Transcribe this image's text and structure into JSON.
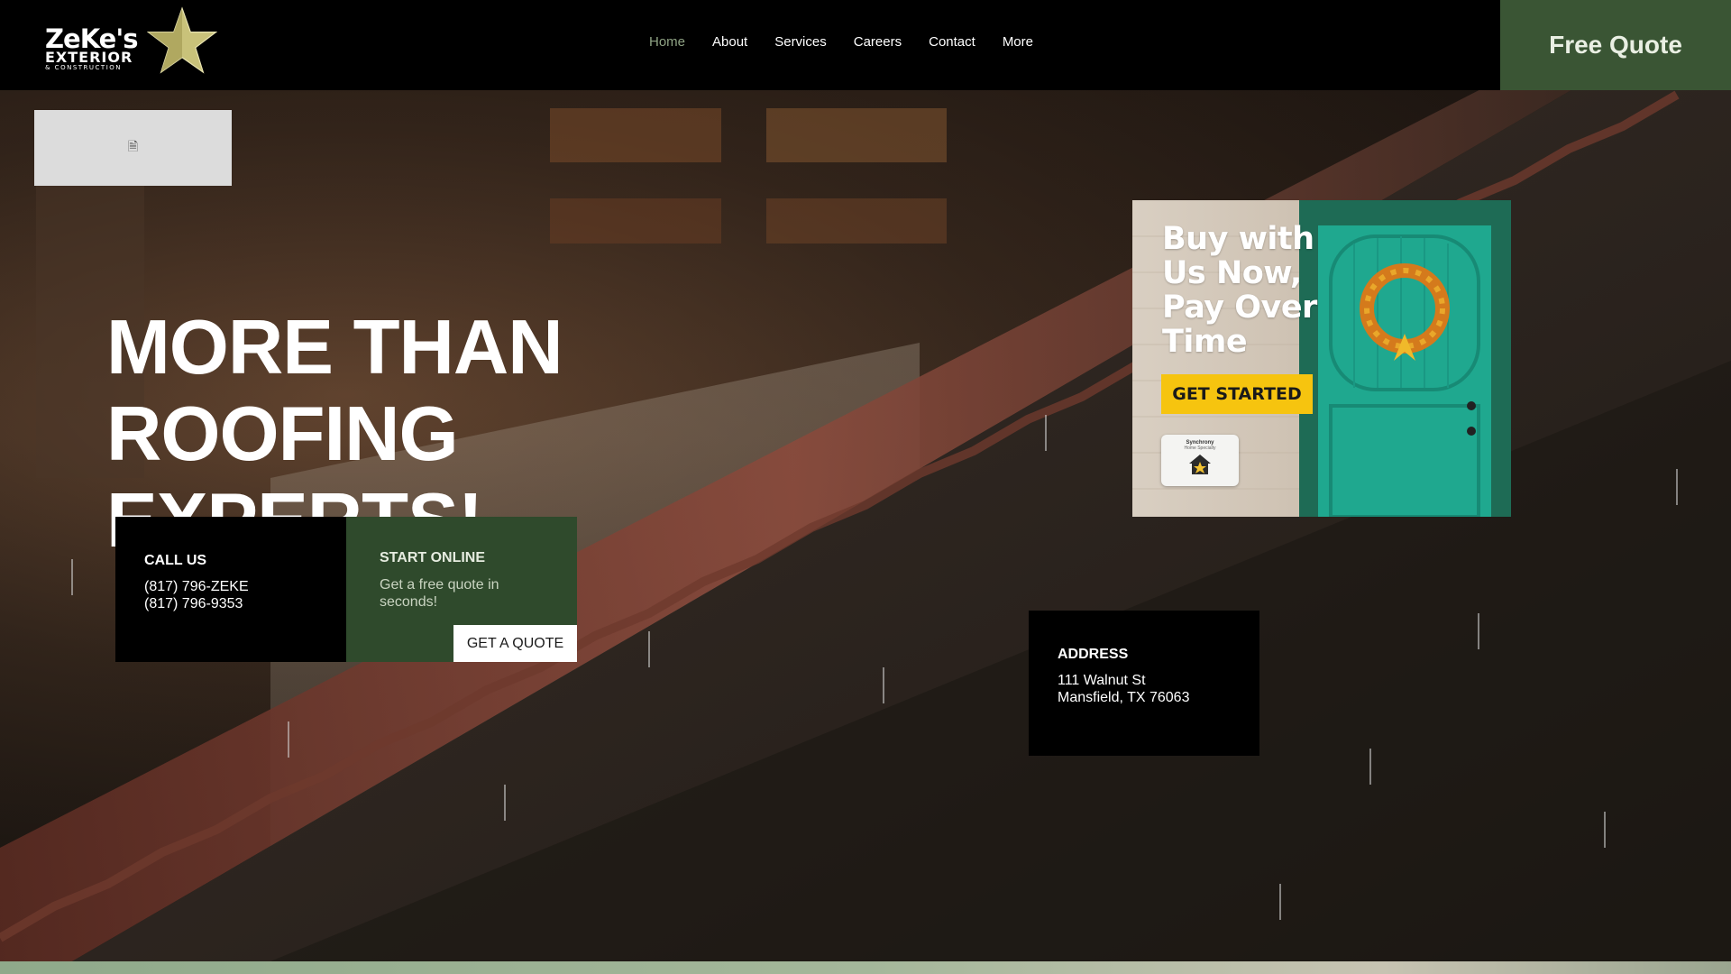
{
  "brand": {
    "name": "ZeKe's",
    "line2": "EXTERIOR",
    "line3": "& CONSTRUCTION",
    "logo_icon": "star-icon"
  },
  "nav": {
    "items": [
      {
        "label": "Home",
        "active": true
      },
      {
        "label": "About",
        "active": false
      },
      {
        "label": "Services",
        "active": false
      },
      {
        "label": "Careers",
        "active": false
      },
      {
        "label": "Contact",
        "active": false
      },
      {
        "label": "More",
        "active": false
      }
    ]
  },
  "header_cta": {
    "label": "Free Quote"
  },
  "placeholder": {
    "icon": "document-icon"
  },
  "hero": {
    "headline_line1": "MORE THAN ROOFING",
    "headline_line2": "EXPERTS!"
  },
  "call_card": {
    "title": "CALL US",
    "phone1": "(817) 796-ZEKE",
    "phone2": "(817) 796-9353"
  },
  "online_card": {
    "title": "START ONLINE",
    "description": "Get a free quote in seconds!",
    "button_label": "GET A QUOTE"
  },
  "address_card": {
    "title": "ADDRESS",
    "line1": "111 Walnut St",
    "line2": "Mansfield, TX 76063"
  },
  "promo": {
    "headline": "Buy with Us Now, Pay Over Time",
    "cta": "GET STARTED",
    "partner_name": "Synchrony",
    "partner_sub": "Home Specialty"
  },
  "colors": {
    "header_bg": "#000000",
    "brand_green": "#3a5534",
    "nav_active": "#8fa384",
    "promo_yellow": "#f6c40f",
    "door_teal": "#1fa88f"
  }
}
